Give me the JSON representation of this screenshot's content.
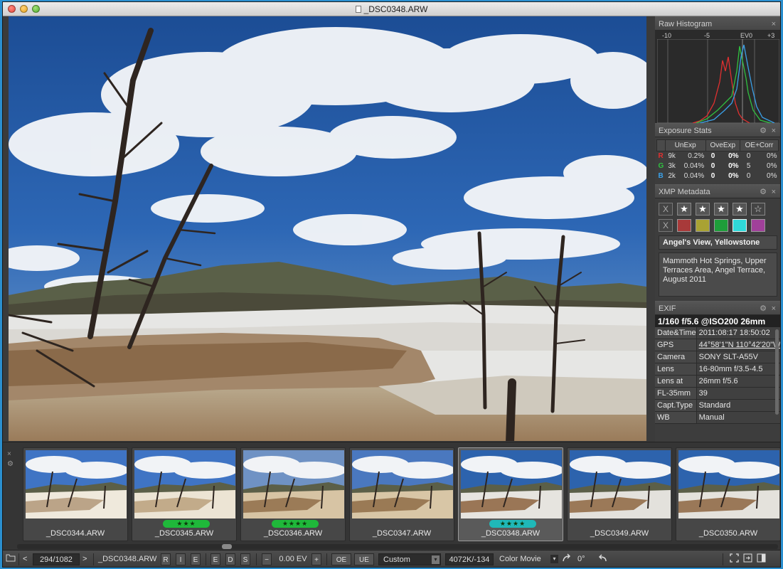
{
  "window": {
    "title": "_DSC0348.ARW"
  },
  "panels": {
    "histogram": {
      "title": "Raw Histogram",
      "scale": [
        "-10",
        "-5",
        "EV0",
        "+3"
      ]
    },
    "exposure_stats": {
      "title": "Exposure Stats",
      "headers": [
        "UnExp",
        "OveExp",
        "OE+Corr"
      ],
      "rows": [
        {
          "ch": "R",
          "color": "#e03030",
          "c1": "9k",
          "c2": "0.2%",
          "c3": "0",
          "c4": "0%",
          "c5": "0",
          "c6": "0%"
        },
        {
          "ch": "G",
          "color": "#30c040",
          "c1": "3k",
          "c2": "0.04%",
          "c3": "0",
          "c4": "0%",
          "c5": "5",
          "c6": "0%"
        },
        {
          "ch": "B",
          "color": "#3aa0e8",
          "c1": "2k",
          "c2": "0.04%",
          "c3": "0",
          "c4": "0%",
          "c5": "0",
          "c6": "0%"
        }
      ]
    },
    "xmp": {
      "title": "XMP Metadata",
      "reject_label": "X",
      "clear_label": "X",
      "star_glyph": "★",
      "empty_star_glyph": "☆",
      "label_colors": [
        "#a83a3a",
        "#a9a233",
        "#1e9e3a",
        "#2fd8d8",
        "#a0409a"
      ],
      "caption_title": "Angel's View, Yellowstone",
      "caption_desc": "Mammoth Hot Springs, Upper Terraces Area, Angel Terrace, August 2011"
    },
    "exif": {
      "title": "EXIF",
      "summary": "1/160 f/5.6 @ISO200 26mm",
      "rows": [
        {
          "k": "Date&Time",
          "v": "2011:08:17 18:50:02"
        },
        {
          "k": "GPS",
          "v": "44°58'1\"N 110°42'20\"W"
        },
        {
          "k": "Camera",
          "v": "SONY SLT-A55V"
        },
        {
          "k": "Lens",
          "v": "16-80mm f/3.5-4.5"
        },
        {
          "k": "Lens at",
          "v": "26mm f/5.6"
        },
        {
          "k": "FL-35mm",
          "v": "39"
        },
        {
          "k": "Capt.Type",
          "v": "Standard"
        },
        {
          "k": "WB",
          "v": "Manual"
        }
      ]
    },
    "close_glyph": "×",
    "gear_glyph": "⚙"
  },
  "filmstrip": {
    "close_glyph": "×",
    "gear_glyph": "⚙",
    "thumbs": [
      {
        "name": "_DSC0344.ARW",
        "rating": "",
        "rating_color": "",
        "selected": false
      },
      {
        "name": "_DSC0345.ARW",
        "rating": "★★★",
        "rating_color": "#1fb83a",
        "selected": false
      },
      {
        "name": "_DSC0346.ARW",
        "rating": "★★★★",
        "rating_color": "#1fb83a",
        "selected": false
      },
      {
        "name": "_DSC0347.ARW",
        "rating": "",
        "rating_color": "",
        "selected": false
      },
      {
        "name": "_DSC0348.ARW",
        "rating": "★★★★",
        "rating_color": "#1fb8b8",
        "selected": true
      },
      {
        "name": "_DSC0349.ARW",
        "rating": "",
        "rating_color": "",
        "selected": false
      },
      {
        "name": "_DSC0350.ARW",
        "rating": "",
        "rating_color": "",
        "selected": false
      }
    ]
  },
  "toolbar": {
    "folder_icon": "folder-icon",
    "prev": "<",
    "next": ">",
    "counter": "294/1082",
    "filename": "_DSC0348.ARW",
    "r_btn": "R",
    "i_btn": "I",
    "e_btn": "E",
    "ed_btn": "E",
    "d_btn": "D",
    "s_btn": "S",
    "minus": "−",
    "ev_value": "0.00 EV",
    "plus": "+",
    "oe_btn": "OE",
    "ue_btn": "UE",
    "profile": "Custom",
    "wb_value": "4072K/-134",
    "color_mode": "Color Movie",
    "rotation": "0°"
  }
}
